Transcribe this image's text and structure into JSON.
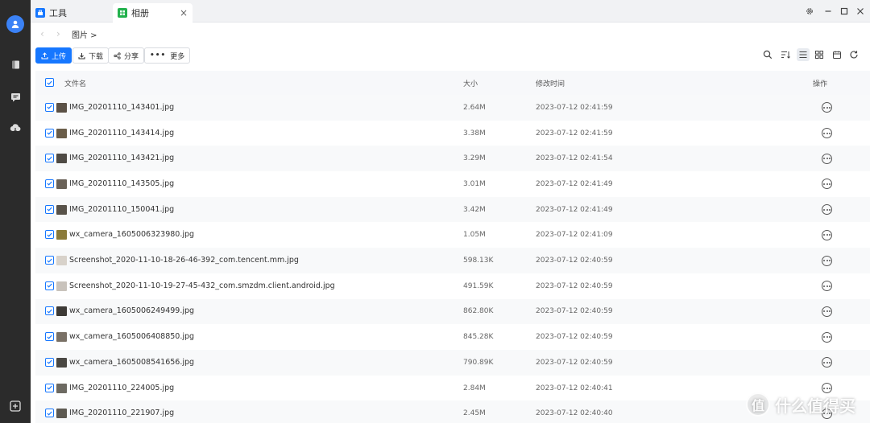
{
  "tabs": [
    {
      "label": "工具",
      "active": false
    },
    {
      "label": "相册",
      "active": true
    }
  ],
  "breadcrumb": "图片 >",
  "toolbar": {
    "upload": "上传",
    "download": "下载",
    "share": "分享",
    "more": "更多"
  },
  "table": {
    "headers": {
      "name": "文件名",
      "size": "大小",
      "modified": "修改时间",
      "actions": "操作"
    },
    "rows": [
      {
        "name": "IMG_20201110_143401.jpg",
        "size": "2.64M",
        "modified": "2023-07-12 02:41:59"
      },
      {
        "name": "IMG_20201110_143414.jpg",
        "size": "3.38M",
        "modified": "2023-07-12 02:41:59"
      },
      {
        "name": "IMG_20201110_143421.jpg",
        "size": "3.29M",
        "modified": "2023-07-12 02:41:54"
      },
      {
        "name": "IMG_20201110_143505.jpg",
        "size": "3.01M",
        "modified": "2023-07-12 02:41:49"
      },
      {
        "name": "IMG_20201110_150041.jpg",
        "size": "3.42M",
        "modified": "2023-07-12 02:41:49"
      },
      {
        "name": "wx_camera_1605006323980.jpg",
        "size": "1.05M",
        "modified": "2023-07-12 02:41:09"
      },
      {
        "name": "Screenshot_2020-11-10-18-26-46-392_com.tencent.mm.jpg",
        "size": "598.13K",
        "modified": "2023-07-12 02:40:59"
      },
      {
        "name": "Screenshot_2020-11-10-19-27-45-432_com.smzdm.client.android.jpg",
        "size": "491.59K",
        "modified": "2023-07-12 02:40:59"
      },
      {
        "name": "wx_camera_1605006249499.jpg",
        "size": "862.80K",
        "modified": "2023-07-12 02:40:59"
      },
      {
        "name": "wx_camera_1605006408850.jpg",
        "size": "845.28K",
        "modified": "2023-07-12 02:40:59"
      },
      {
        "name": "wx_camera_1605008541656.jpg",
        "size": "790.89K",
        "modified": "2023-07-12 02:40:59"
      },
      {
        "name": "IMG_20201110_224005.jpg",
        "size": "2.84M",
        "modified": "2023-07-12 02:40:41"
      },
      {
        "name": "IMG_20201110_221907.jpg",
        "size": "2.45M",
        "modified": "2023-07-12 02:40:40"
      }
    ]
  },
  "watermark": {
    "badge": "值",
    "text": "什么值得买"
  },
  "colors": {
    "accent": "#1677ff",
    "rail": "#2b2b2b"
  }
}
